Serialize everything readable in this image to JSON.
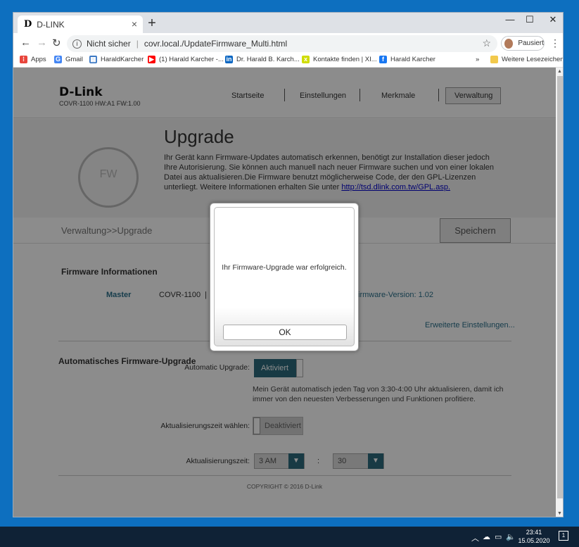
{
  "browser": {
    "tab_title": "D-LINK",
    "tab_favicon": "D",
    "tab_close": "×",
    "new_tab": "+",
    "minimize": "—",
    "maximize": "☐",
    "close": "✕",
    "back": "←",
    "forward": "→",
    "reload": "↻",
    "security_label": "Nicht sicher",
    "url": "covr.local./UpdateFirmware_Multi.html",
    "star": "☆",
    "profile_label": "Pausiert",
    "menu": "⋮",
    "bookmarks": [
      {
        "label": "Apps",
        "icon": "apps-grid-icon",
        "color": "#e8453c"
      },
      {
        "label": "Gmail",
        "icon": "google-g-icon",
        "color": "#4285f4"
      },
      {
        "label": "HaraldKarcher",
        "icon": "calendar-icon",
        "color": "#3b78c4"
      },
      {
        "label": "(1) Harald Karcher -...",
        "icon": "youtube-icon",
        "color": "#ff0000"
      },
      {
        "label": "Dr. Harald B. Karch...",
        "icon": "linkedin-icon",
        "color": "#0a66c2"
      },
      {
        "label": "Kontakte finden | XI...",
        "icon": "xing-icon",
        "color": "#cfdc00"
      },
      {
        "label": "Harald Karcher",
        "icon": "facebook-icon",
        "color": "#1877f2"
      }
    ],
    "bookmarks_overflow": "»",
    "other_bookmarks": "Weitere Lesezeichen"
  },
  "router": {
    "logo": "D-Link",
    "model": "COVR-1100 HW:A1 FW:1.00",
    "nav": [
      "Startseite",
      "Einstellungen",
      "Merkmale",
      "Verwaltung"
    ],
    "page_title": "Upgrade",
    "fw_icon_text": "FW",
    "description": "Ihr Gerät kann Firmware-Updates automatisch erkennen, benötigt zur Installation dieser jedoch Ihre Autorisierung. Sie können auch manuell nach neuer Firmware suchen und von einer lokalen Datei aus aktualisieren.Die Firmware benutzt möglicherweise Code, der den GPL-Lizenzen unterliegt. Weitere Informationen erhalten Sie unter",
    "gpl_link": "http://tsd.dlink.com.tw/GPL.asp.",
    "breadcrumb": "Verwaltung>>Upgrade",
    "save": "Speichern",
    "fw_info_title": "Firmware Informationen",
    "fw_role": "Master",
    "fw_model": "COVR-1100",
    "fw_sep": "|",
    "fw_version": "irmware-Version: 1.02",
    "advanced_link": "Erweiterte Einstellungen...",
    "auto_title": "Automatisches Firmware-Upgrade",
    "auto_upgrade_label": "Automatic Upgrade:",
    "auto_upgrade_value": "Aktiviert",
    "auto_note": "Mein Gerät automatisch jeden Tag von 3:30-4:00 Uhr aktualisieren, damit ich immer von den neuesten Verbesserungen und Funktionen profitiere.",
    "time_select_label": "Aktualisierungszeit wählen:",
    "time_select_value": "Deaktiviert",
    "time_label": "Aktualisierungszeit:",
    "hour_value": "3 AM",
    "colon": ":",
    "minute_value": "30",
    "copyright": "COPYRIGHT © 2016 D-Link"
  },
  "modal": {
    "message": "Ihr Firmware-Upgrade war erfolgreich.",
    "ok": "OK"
  },
  "taskbar": {
    "time": "23:41",
    "date": "15.05.2020",
    "notifications": "1"
  },
  "colors": {
    "accent_teal": "#2c6b7c",
    "desktop_blue": "#0d6fbf",
    "taskbar": "#0f2236"
  }
}
